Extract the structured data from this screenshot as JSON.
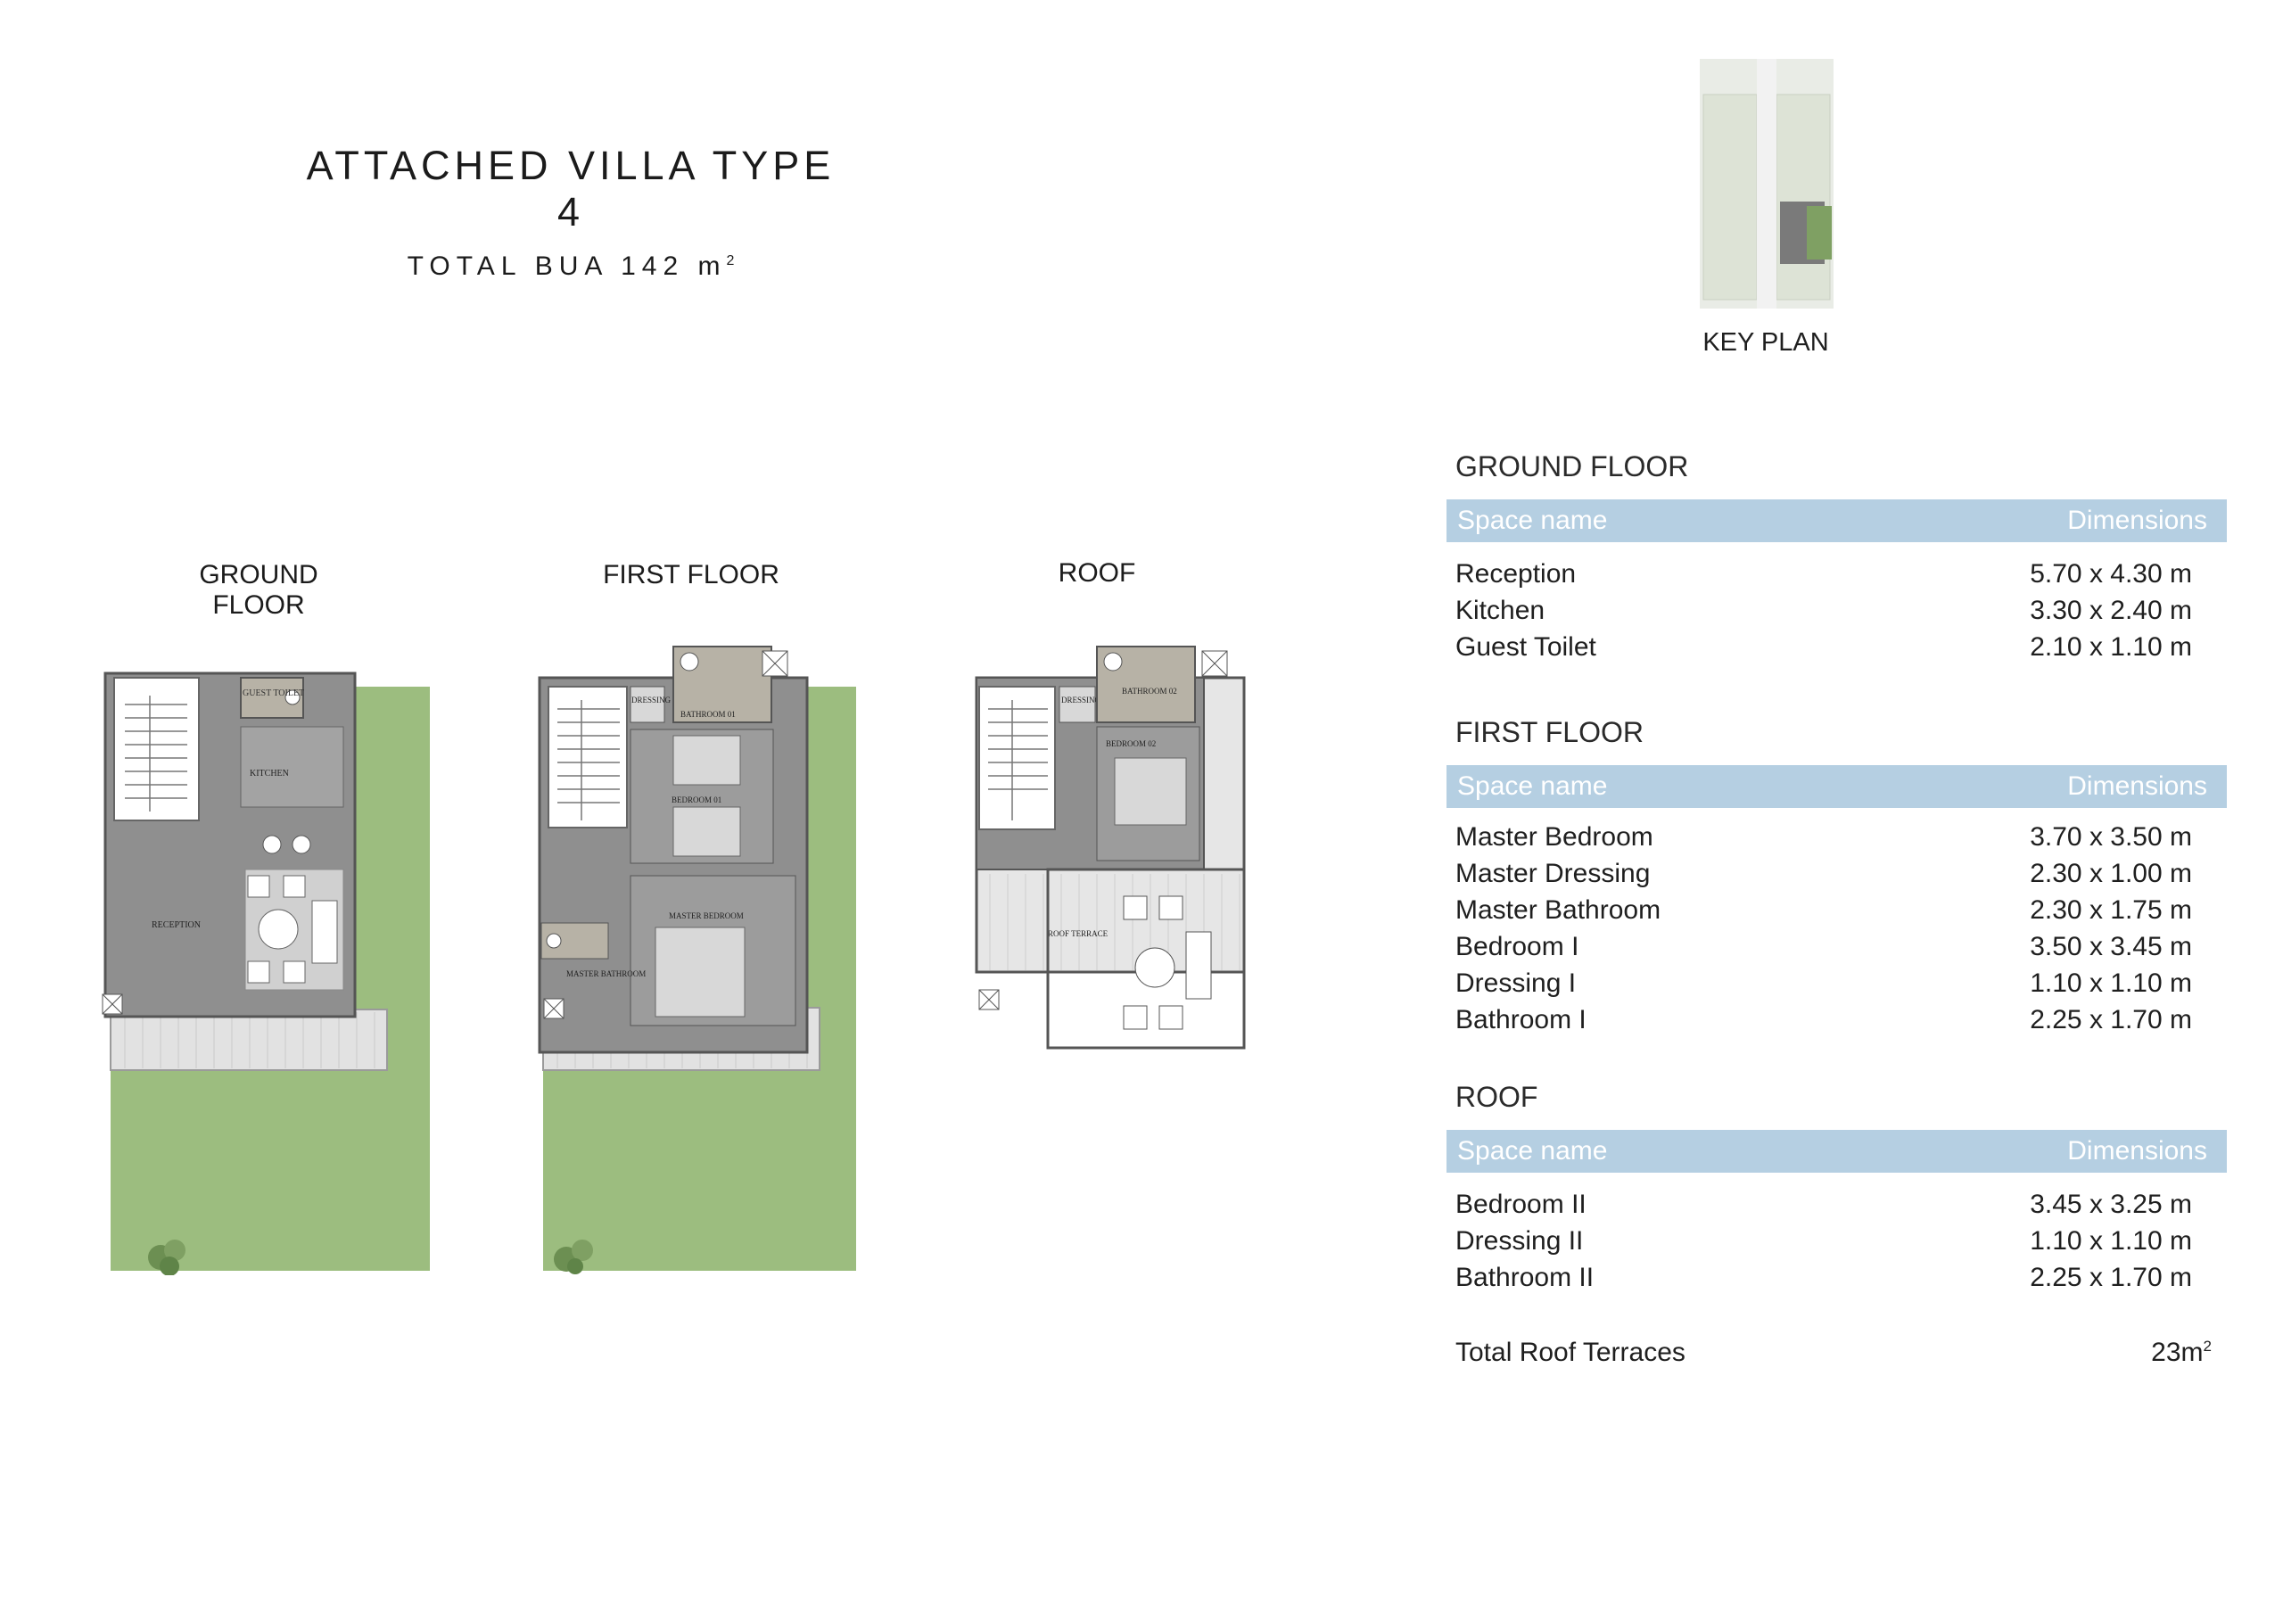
{
  "header": {
    "title": "ATTACHED VILLA TYPE 4",
    "subtitle_prefix": "TOTAL BUA 142 m",
    "subtitle_sup": "2"
  },
  "plans": {
    "ground_label": "GROUND FLOOR",
    "first_label": "FIRST FLOOR",
    "roof_label": "ROOF",
    "ground_rooms": {
      "guest_toilet": "GUEST TOILET",
      "kitchen": "KITCHEN",
      "reception": "RECEPTION"
    },
    "first_rooms": {
      "dressing01": "DRESSING 01",
      "bathroom01": "BATHROOM 01",
      "bedroom01": "BEDROOM 01",
      "master_bedroom": "MASTER BEDROOM",
      "master_bathroom": "MASTER BATHROOM"
    },
    "roof_rooms": {
      "dressing02": "DRESSING 02",
      "bathroom02": "BATHROOM 02",
      "bedroom02": "BEDROOM 02",
      "roof_terrace": "ROOF TERRACE"
    }
  },
  "key_plan": {
    "label": "KEY PLAN"
  },
  "tables": {
    "header": {
      "name": "Space name",
      "dims": "Dimensions"
    },
    "ground": {
      "title": "GROUND FLOOR",
      "rows": [
        {
          "name": "Reception",
          "dims": "5.70 x 4.30 m"
        },
        {
          "name": "Kitchen",
          "dims": "3.30 x 2.40 m"
        },
        {
          "name": "Guest Toilet",
          "dims": "2.10 x 1.10 m"
        }
      ]
    },
    "first": {
      "title": "FIRST FLOOR",
      "rows": [
        {
          "name": "Master Bedroom",
          "dims": "3.70 x 3.50 m"
        },
        {
          "name": "Master Dressing",
          "dims": "2.30 x 1.00 m"
        },
        {
          "name": "Master Bathroom",
          "dims": "2.30 x 1.75 m"
        },
        {
          "name": "Bedroom I",
          "dims": "3.50 x 3.45 m"
        },
        {
          "name": "Dressing I",
          "dims": "1.10 x 1.10 m"
        },
        {
          "name": "Bathroom I",
          "dims": "2.25 x 1.70 m"
        }
      ]
    },
    "roof": {
      "title": "ROOF",
      "rows": [
        {
          "name": "Bedroom II",
          "dims": "3.45 x 3.25 m"
        },
        {
          "name": "Dressing II",
          "dims": "1.10 x 1.10 m"
        },
        {
          "name": "Bathroom II",
          "dims": "2.25 x 1.70 m"
        }
      ]
    }
  },
  "total": {
    "label": "Total Roof Terraces",
    "value_prefix": "23m",
    "value_sup": "2"
  },
  "colors": {
    "header_blue": "#b5cfe2",
    "grass": "#9cbd7f",
    "floor_grey": "#8f8f8f"
  }
}
